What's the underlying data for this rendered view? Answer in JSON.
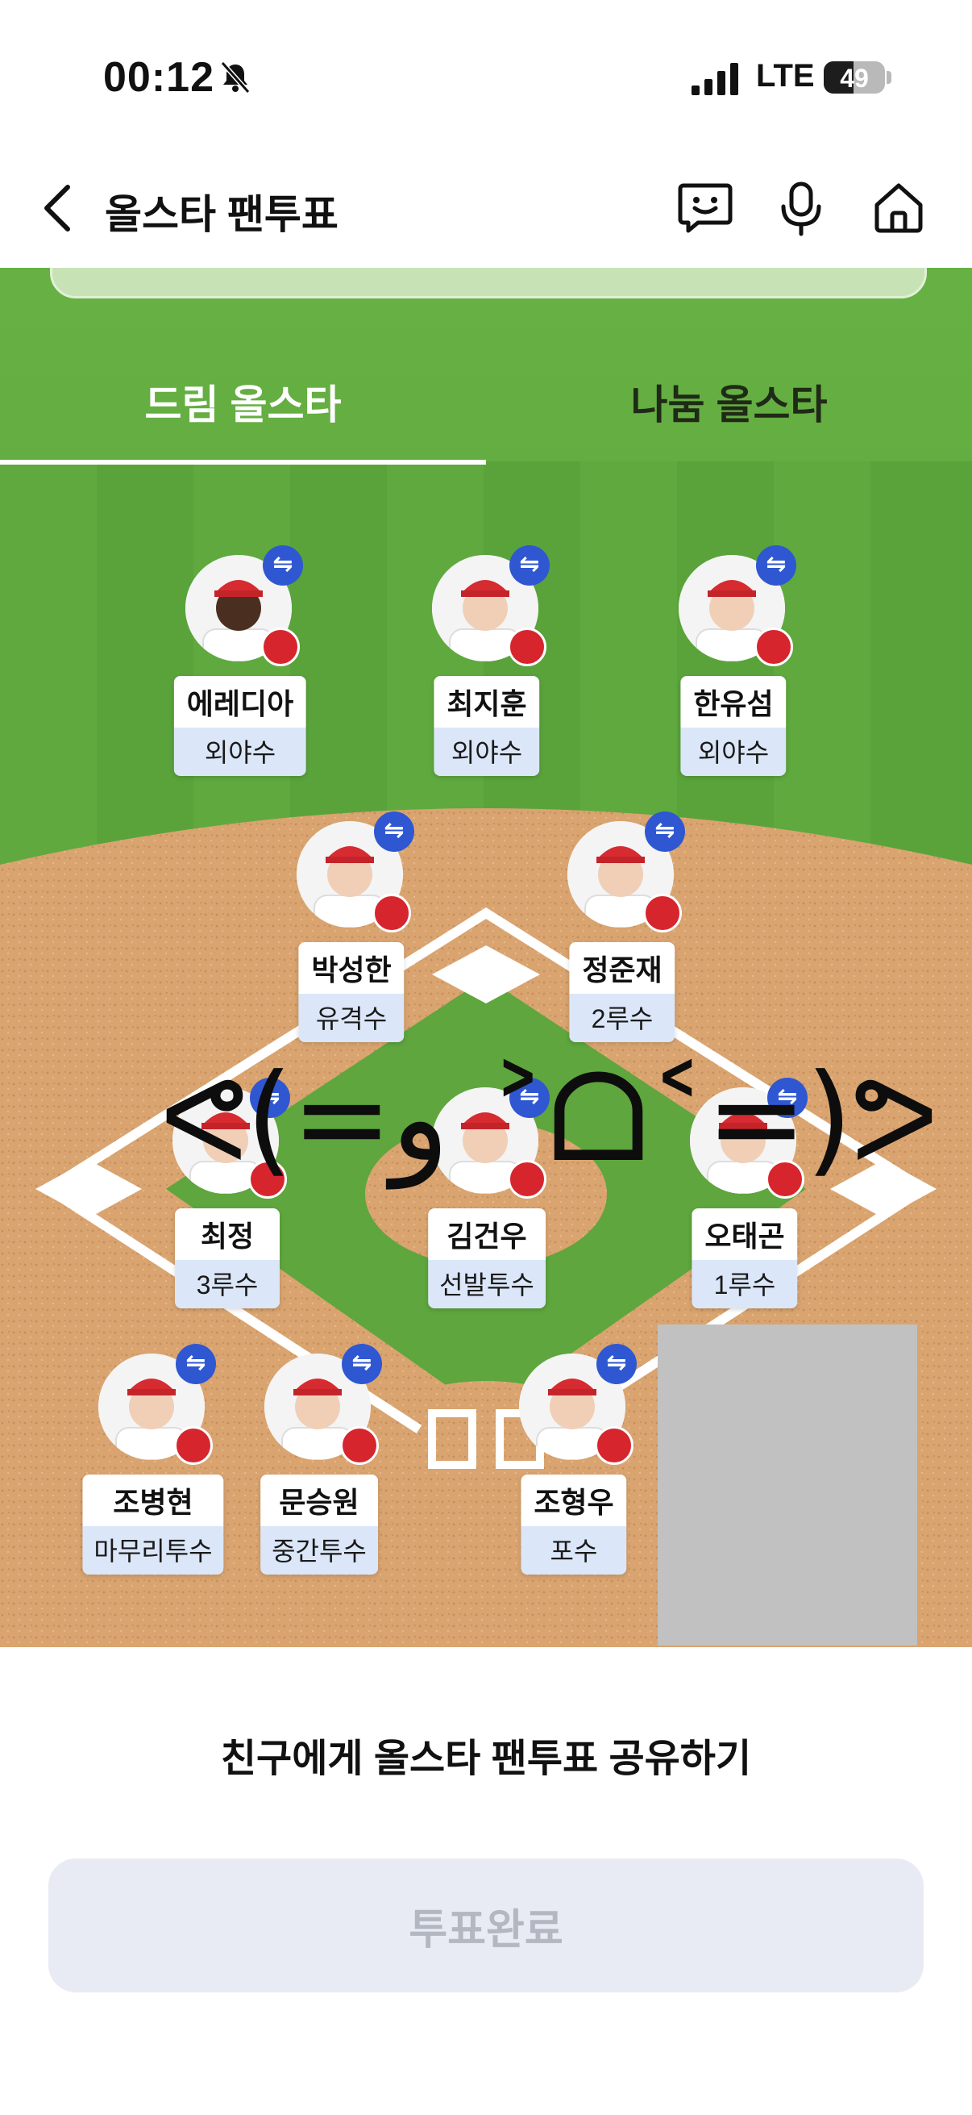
{
  "status_bar": {
    "time": "00:12",
    "network": "LTE",
    "battery": "49",
    "battery_level": 0.49
  },
  "header": {
    "title": "올스타 팬투표"
  },
  "tabs": [
    {
      "label": "드림 올스타",
      "active": true
    },
    {
      "label": "나눔 올스타",
      "active": false
    }
  ],
  "swap_glyph": "⇋",
  "players": {
    "lf": {
      "name": "에레디아",
      "position": "외야수"
    },
    "cf": {
      "name": "최지훈",
      "position": "외야수"
    },
    "rf": {
      "name": "한유섬",
      "position": "외야수"
    },
    "ss": {
      "name": "박성한",
      "position": "유격수"
    },
    "second": {
      "name": "정준재",
      "position": "2루수"
    },
    "third": {
      "name": "최정",
      "position": "3루수"
    },
    "sp": {
      "name": "김건우",
      "position": "선발투수"
    },
    "first": {
      "name": "오태곤",
      "position": "1루수"
    },
    "cl": {
      "name": "조병현",
      "position": "마무리투수"
    },
    "rp": {
      "name": "문승원",
      "position": "중간투수"
    },
    "c": {
      "name": "조형우",
      "position": "포수"
    }
  },
  "overlay_text": "ᕙ(=و ˃ᗝ˂=)ᕗ",
  "share_text": "친구에게 올스타 팬투표 공유하기",
  "vote_button": "투표완료",
  "colors": {
    "field_green": "#5ea63d",
    "dirt": "#d9a470",
    "swap_blue": "#2f57d1",
    "team_red": "#d7252d"
  }
}
